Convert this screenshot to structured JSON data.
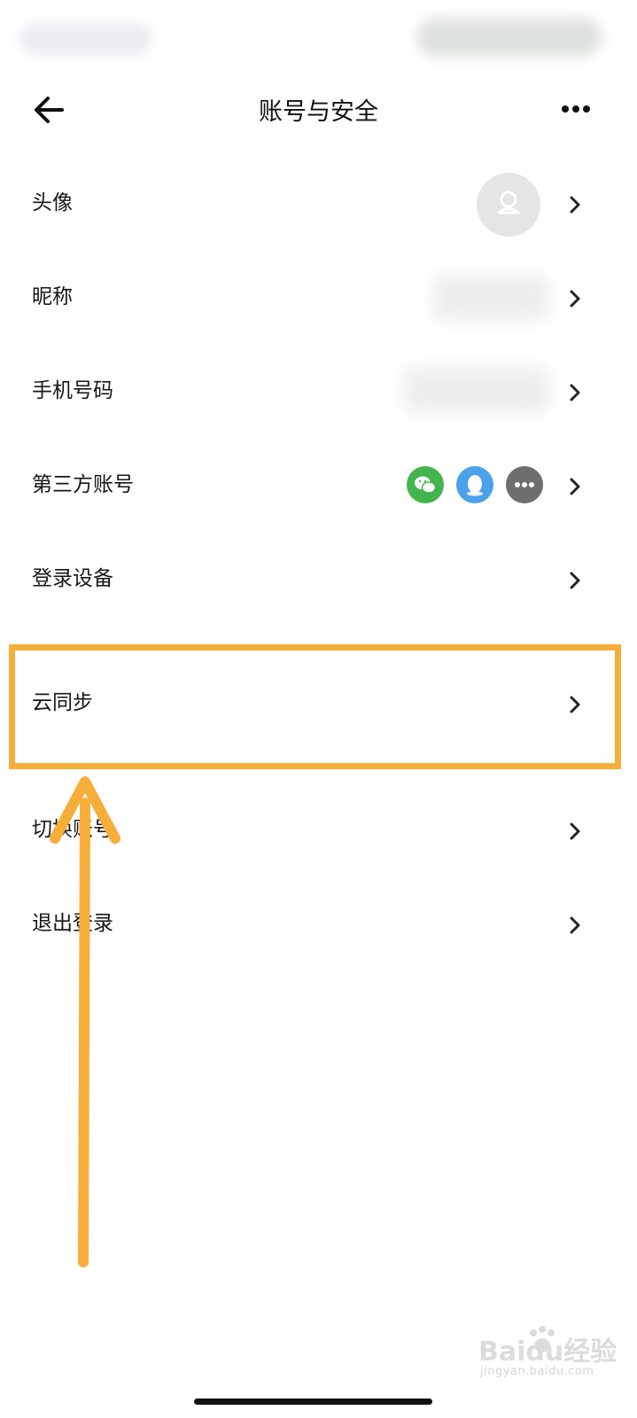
{
  "header": {
    "title": "账号与安全",
    "back_icon": "arrow-left-icon",
    "more_icon": "more-horizontal-icon"
  },
  "rows": [
    {
      "label": "头像",
      "trailing": "avatar"
    },
    {
      "label": "昵称",
      "trailing": "hidden-value"
    },
    {
      "label": "手机号码",
      "trailing": "hidden-value"
    },
    {
      "label": "第三方账号",
      "trailing": [
        "wechat-icon",
        "qq-icon",
        "more-icon"
      ]
    },
    {
      "label": "登录设备"
    },
    {
      "label": "云同步",
      "highlighted": true
    },
    {
      "label": "切换账号"
    },
    {
      "label": "退出登录"
    }
  ],
  "annotation": {
    "color": "#f7ad3a",
    "arrow_direction": "up"
  },
  "watermark": {
    "text": "Baidu经验",
    "sub": "jingyan.baidu.com"
  }
}
